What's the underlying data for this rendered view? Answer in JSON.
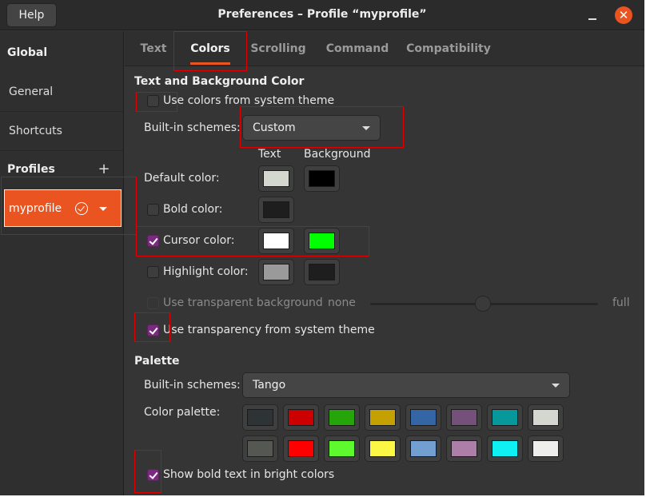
{
  "window": {
    "title": "Preferences – Profile “myprofile”",
    "help_label": "Help",
    "close_glyph": "✕"
  },
  "sidebar": {
    "global_heading": "Global",
    "general_label": "General",
    "shortcuts_label": "Shortcuts",
    "profiles_heading": "Profiles",
    "add_glyph": "+",
    "profile_name": "myprofile"
  },
  "tabs": [
    "Text",
    "Colors",
    "Scrolling",
    "Command",
    "Compatibility"
  ],
  "active_tab": "Colors",
  "text_bg": {
    "section_title": "Text and Background Color",
    "use_system_label": "Use colors from system theme",
    "use_system_checked": false,
    "builtin_label": "Built-in schemes:",
    "builtin_value": "Custom",
    "col_text": "Text",
    "col_background": "Background",
    "default_label": "Default color:",
    "default_text_color": "#d3d7cf",
    "default_bg_color": "#000000",
    "bold_label": "Bold color:",
    "bold_checked": false,
    "bold_color": "#1e1e1e",
    "cursor_label": "Cursor color:",
    "cursor_checked": true,
    "cursor_text_color": "#ffffff",
    "cursor_bg_color": "#00ff00",
    "highlight_label": "Highlight color:",
    "highlight_checked": false,
    "highlight_text_color": "#9a9a9a",
    "highlight_bg_color": "#1e1e1e",
    "transparent_label": "Use transparent background",
    "transparent_checked": false,
    "slider_min": "none",
    "slider_max": "full",
    "system_transparency_label": "Use transparency from system theme",
    "system_transparency_checked": true
  },
  "palette": {
    "section_title": "Palette",
    "builtin_label": "Built-in schemes:",
    "builtin_value": "Tango",
    "palette_label": "Color palette:",
    "colors": [
      "#2e3436",
      "#cc0000",
      "#25a50a",
      "#c4a000",
      "#3465a4",
      "#75507b",
      "#06989a",
      "#d3d7cf",
      "#555753",
      "#ff0000",
      "#5efa2e",
      "#fcf645",
      "#729fcf",
      "#ad7fa8",
      "#0ff0f2",
      "#eeeeec"
    ],
    "bright_label": "Show bold text in bright colors",
    "bright_checked": true
  },
  "colors": {
    "accent": "#e95420",
    "checkbox_checked": "#7b2b7f",
    "annotation": "#e00000"
  }
}
